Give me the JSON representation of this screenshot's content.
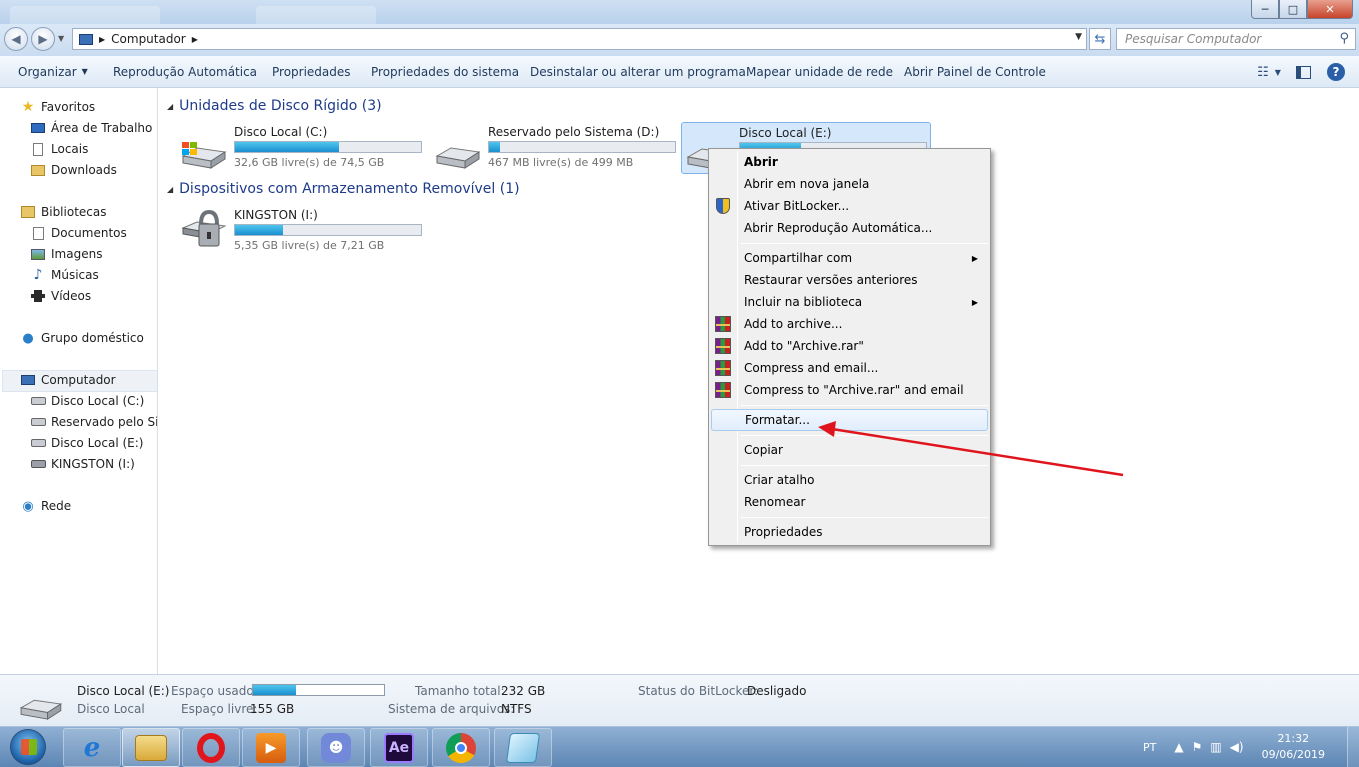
{
  "window": {
    "search_placeholder": "Pesquisar Computador",
    "address": [
      "Computador"
    ],
    "controls": {
      "minimize": "─",
      "maximize": "□",
      "close": "✕"
    }
  },
  "toolbar": {
    "organize": "Organizar",
    "autoplay": "Reprodução Automática",
    "properties": "Propriedades",
    "system_properties": "Propriedades do sistema",
    "uninstall": "Desinstalar ou alterar um programa",
    "map_drive": "Mapear unidade de rede",
    "control_panel": "Abrir Painel de Controle"
  },
  "nav": {
    "favorites": "Favoritos",
    "desktop": "Área de Trabalho",
    "places": "Locais",
    "downloads": "Downloads",
    "libraries": "Bibliotecas",
    "documents": "Documentos",
    "images": "Imagens",
    "music": "Músicas",
    "videos": "Vídeos",
    "homegroup": "Grupo doméstico",
    "computer": "Computador",
    "drive_c": "Disco Local (C:)",
    "drive_d": "Reservado pelo Siste",
    "drive_e": "Disco Local (E:)",
    "drive_i": "KINGSTON (I:)",
    "network": "Rede"
  },
  "groups": {
    "hdd": "Unidades de Disco Rígido (3)",
    "removable": "Dispositivos com Armazenamento Removível (1)"
  },
  "drives": [
    {
      "name": "Disco Local (C:)",
      "free": "32,6 GB livre(s) de 74,5 GB",
      "used_fraction": 0.56
    },
    {
      "name": "Reservado pelo Sistema (D:)",
      "free": "467 MB livre(s) de 499 MB",
      "used_fraction": 0.06
    },
    {
      "name": "Disco Local (E:)",
      "free": "",
      "used_fraction": 0.33
    },
    {
      "name": "KINGSTON (I:)",
      "free": "5,35 GB livre(s) de 7,21 GB",
      "used_fraction": 0.26
    }
  ],
  "context_menu": {
    "open": "Abrir",
    "open_new_window": "Abrir em nova janela",
    "bitlocker": "Ativar BitLocker...",
    "autoplay": "Abrir Reprodução Automática...",
    "share": "Compartilhar com",
    "restore": "Restaurar versões anteriores",
    "include_library": "Incluir na biblioteca",
    "add_archive": "Add to archive...",
    "add_archive_rar": "Add to \"Archive.rar\"",
    "compress_email": "Compress and email...",
    "compress_rar_email": "Compress to \"Archive.rar\" and email",
    "format": "Formatar...",
    "copy": "Copiar",
    "shortcut": "Criar atalho",
    "rename": "Renomear",
    "properties": "Propriedades"
  },
  "details": {
    "name": "Disco Local (E:)",
    "type": "Disco Local",
    "used_label": "Espaço usado:",
    "used_fraction": 0.33,
    "free_label": "Espaço livre:",
    "free_value": "155 GB",
    "total_label": "Tamanho total:",
    "total_value": "232 GB",
    "fs_label": "Sistema de arquivos:",
    "fs_value": "NTFS",
    "bitlocker_label": "Status do BitLocker:",
    "bitlocker_value": "Desligado"
  },
  "taskbar": {
    "lang": "PT",
    "time": "21:32",
    "date": "09/06/2019",
    "apps": [
      "Internet Explorer",
      "Windows Explorer",
      "Opera",
      "Media Player",
      "Discord",
      "After Effects",
      "Chrome",
      "Notepad"
    ],
    "ae_label": "Ae"
  },
  "colors": {
    "accent": "#1a8fcf",
    "header_text": "#1e3b8a",
    "annotation_arrow": "#e0141c"
  }
}
